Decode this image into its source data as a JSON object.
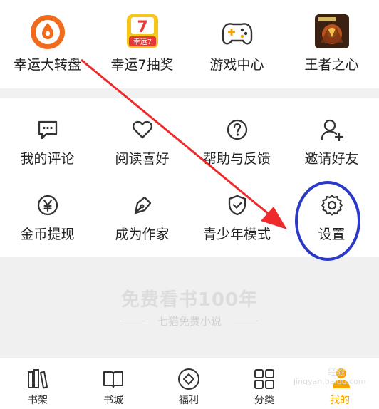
{
  "top_row": [
    {
      "label": "幸运大转盘",
      "icon": "lucky-wheel-icon"
    },
    {
      "label": "幸运7抽奖",
      "icon": "lucky-seven-icon",
      "badge": "幸运7"
    },
    {
      "label": "游戏中心",
      "icon": "gamepad-icon"
    },
    {
      "label": "王者之心",
      "icon": "game-art-icon"
    }
  ],
  "grid_row1": [
    {
      "label": "我的评论",
      "icon": "comment-icon"
    },
    {
      "label": "阅读喜好",
      "icon": "heart-icon"
    },
    {
      "label": "帮助与反馈",
      "icon": "help-icon"
    },
    {
      "label": "邀请好友",
      "icon": "add-user-icon"
    }
  ],
  "grid_row2": [
    {
      "label": "金币提现",
      "icon": "coin-yen-icon"
    },
    {
      "label": "成为作家",
      "icon": "pen-nib-icon"
    },
    {
      "label": "青少年模式",
      "icon": "shield-check-icon"
    },
    {
      "label": "设置",
      "icon": "gear-icon"
    }
  ],
  "promo": {
    "title": "免费看书100年",
    "subtitle": "七猫免费小说"
  },
  "tabbar": [
    {
      "label": "书架",
      "icon": "bookshelf-icon"
    },
    {
      "label": "书城",
      "icon": "book-icon"
    },
    {
      "label": "福利",
      "icon": "diamond-icon"
    },
    {
      "label": "分类",
      "icon": "category-grid-icon"
    },
    {
      "label": "我的",
      "icon": "profile-icon",
      "active": true
    }
  ],
  "annotation": {
    "arrow_color": "#ee2a2a",
    "circle_color": "#2b39c7"
  },
  "watermark": [
    "经验",
    "jingyan.baidu.com"
  ],
  "colors": {
    "accent": "#f7a400",
    "wheel": "#f26b1d"
  }
}
